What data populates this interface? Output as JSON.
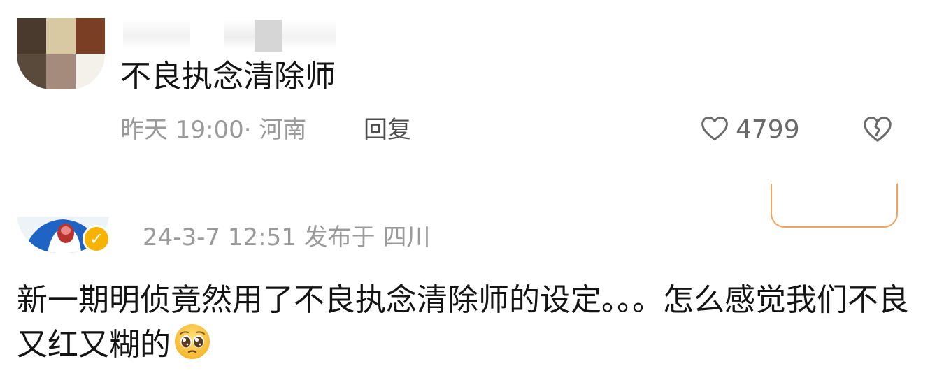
{
  "reply_comment": {
    "avatar_colors": [
      "#4a3a2e",
      "#d9c9a3",
      "#7a3e24",
      "#5a4a3c",
      "#a58b7c",
      "#f4f1ea"
    ],
    "text": "不良执念清除师",
    "time_location": "昨天 19:00· 河南",
    "reply_label": "回复",
    "like_count": "4799",
    "like_icon": "heart-outline-icon",
    "dislike_icon": "broken-heart-icon"
  },
  "post_comment": {
    "verified_badge_icon": "verified-v-icon",
    "verified_color": "#f6b400",
    "meta": "24-3-7 12:51  发布于 四川",
    "text": "新一期明侦竟然用了不良执念清除师的设定。。。怎么感觉我们不良又红又糊的",
    "trailing_emoji": "pleading-face-emoji"
  }
}
